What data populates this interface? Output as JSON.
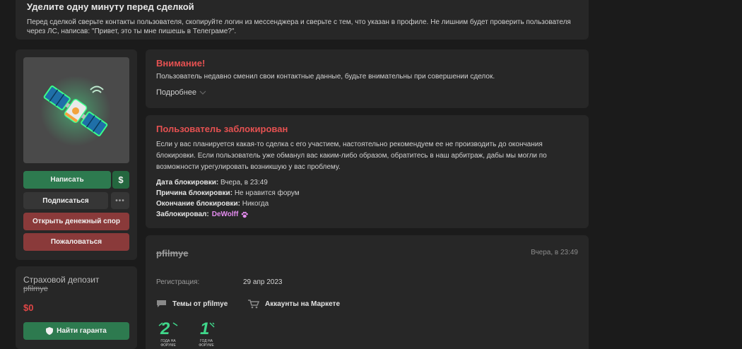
{
  "notice": {
    "title": "Уделите одну минуту перед сделкой",
    "text": "Перед сделкой сверьте контакты пользователя, скопируйте логин из мессенджера и сверьте с тем, что указан в профиле. Не лишним будет проверить пользователя через ЛС, написав: \"Привет, это ты мне пишешь в Телеграме?\"."
  },
  "sidebar": {
    "write_label": "Написать",
    "dollar_label": "$",
    "subscribe_label": "Подписаться",
    "more_label": "•••",
    "dispute_label": "Открыть денежный спор",
    "report_label": "Пожаловаться"
  },
  "deposit": {
    "label": "Страховой депозит",
    "username": "pfilmye",
    "amount": "$0",
    "find_guarantor_label": "Найти гаранта"
  },
  "warning": {
    "title": "Внимание!",
    "text": "Пользователь недавно сменил свои контактные данные, будьте внимательны при совершении сделок.",
    "more_label": "Подробнее"
  },
  "blocked": {
    "title": "Пользователь заблокирован",
    "text": "Если у вас планируется какая-то сделка с его участием, настоятельно рекомендуем ее не производить до окончания блокировки. Если пользователь уже обманул вас каким-либо образом, обратитесь в наш арбитраж, дабы мы могли по возможности урегулировать возникшую у вас проблему.",
    "date_label": "Дата блокировки:",
    "date_value": "Вчера, в 23:49",
    "reason_label": "Причина блокировки:",
    "reason_value": "Не нравится форум",
    "end_label": "Окончание блокировки:",
    "end_value": "Никогда",
    "by_label": "Заблокировал:",
    "by_value": "DeWolff"
  },
  "user": {
    "username": "pfilmye",
    "time": "Вчера, в 23:49",
    "reg_label": "Регистрация:",
    "reg_value": "29 апр 2023",
    "threads_label": "Темы от pfilmye",
    "market_label": "Аккаунты на Маркете",
    "badges": [
      {
        "number": "2",
        "caption": "ГОДА НА ФОРУМЕ"
      },
      {
        "number": "1",
        "caption": "ГОД НА ФОРУМЕ"
      }
    ]
  },
  "colors": {
    "accent_green": "#2d7a4f",
    "danger_red": "#e55151",
    "button_red": "#8a3a3a",
    "moderator_pink": "#e58cf0",
    "badge_green": "#3fd68a"
  }
}
